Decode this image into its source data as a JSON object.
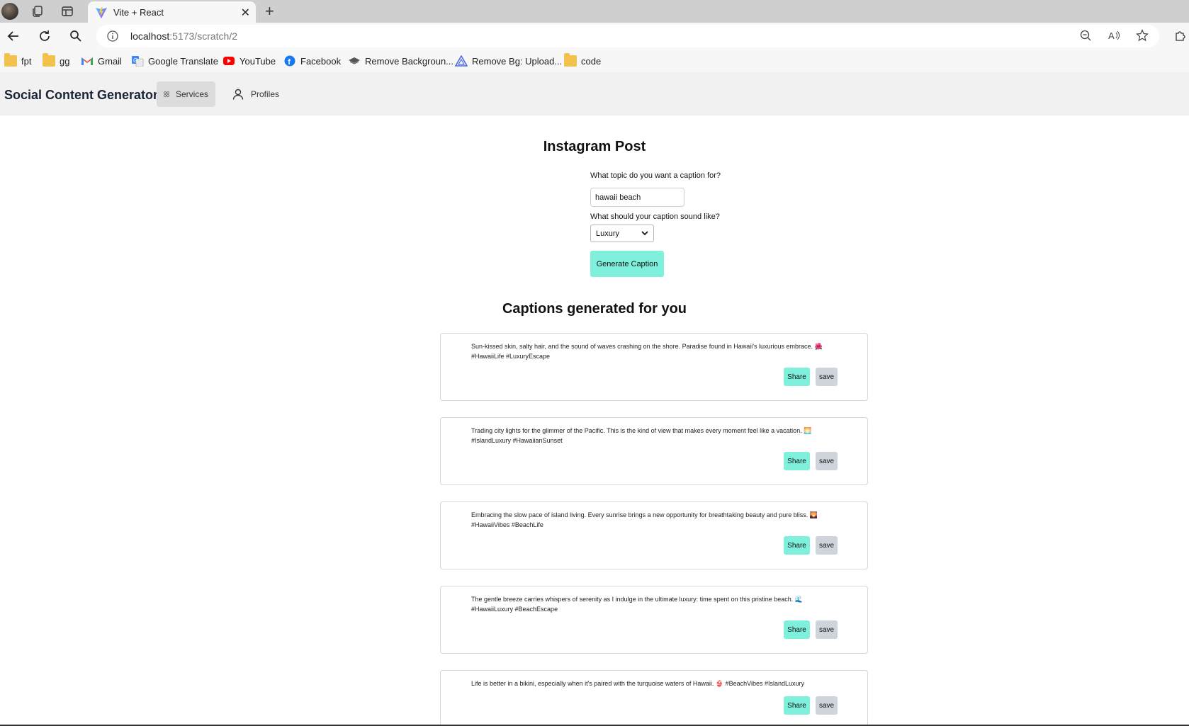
{
  "browser": {
    "tab_title": "Vite + React",
    "url_host": "localhost",
    "url_path": ":5173/scratch/2",
    "bookmarks": [
      {
        "label": "fpt",
        "icon": "folder-icon"
      },
      {
        "label": "gg",
        "icon": "folder-icon"
      },
      {
        "label": "Gmail",
        "icon": "gmail-icon"
      },
      {
        "label": "Google Translate",
        "icon": "translate-icon"
      },
      {
        "label": "YouTube",
        "icon": "youtube-icon"
      },
      {
        "label": "Facebook",
        "icon": "facebook-icon"
      },
      {
        "label": "Remove Backgroun...",
        "icon": "layers-icon"
      },
      {
        "label": "Remove Bg: Upload...",
        "icon": "triangle-logo-icon"
      },
      {
        "label": "code",
        "icon": "folder-icon"
      }
    ]
  },
  "app": {
    "brand": "Social Content Generator",
    "nav": {
      "services": "Services",
      "profiles": "Profiles"
    }
  },
  "form": {
    "title": "Instagram Post",
    "topic_label": "What topic do you want a caption for?",
    "topic_value": "hawaii beach",
    "tone_label": "What should your caption sound like?",
    "tone_value": "Luxury",
    "generate_label": "Generate Caption"
  },
  "results": {
    "title": "Captions generated for you",
    "share_label": "Share",
    "save_label": "save",
    "captions": [
      "Sun-kissed skin, salty hair, and the sound of waves crashing on the shore. Paradise found in Hawaii's luxurious embrace. 🌺 #HawaiiLife #LuxuryEscape",
      "Trading city lights for the glimmer of the Pacific. This is the kind of view that makes every moment feel like a vacation. 🌅 #IslandLuxury #HawaiianSunset",
      "Embracing the slow pace of island living. Every sunrise brings a new opportunity for breathtaking beauty and pure bliss. 🌄 #HawaiiVibes #BeachLife",
      "The gentle breeze carries whispers of serenity as I indulge in the ultimate luxury: time spent on this pristine beach. 🌊 #HawaiiLuxury #BeachEscape",
      "Life is better in a bikini, especially when it's paired with the turquoise waters of Hawaii. 👙 #BeachVibes #IslandLuxury"
    ]
  },
  "colors": {
    "accent": "#7ef0db",
    "secondary_button": "#cfd3db",
    "navbar_bg": "#f1f1f1",
    "brand_text": "#1a2437"
  }
}
